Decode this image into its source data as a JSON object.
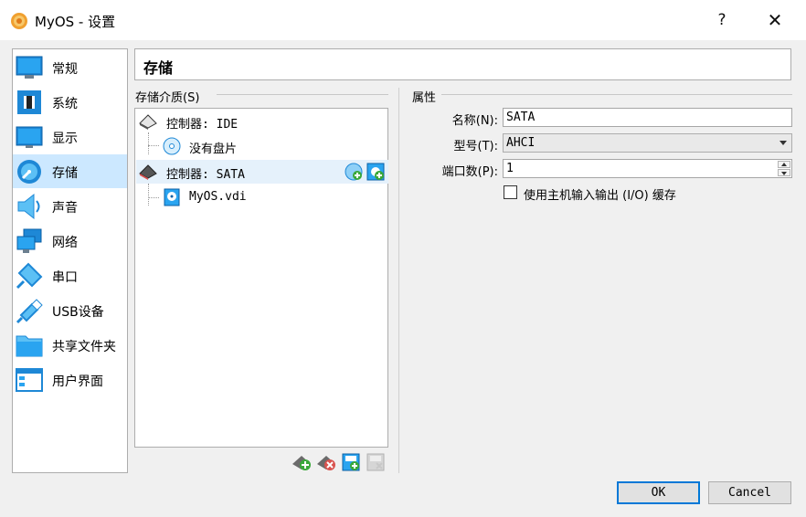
{
  "window": {
    "title": "MyOS - 设置",
    "help_glyph": "?",
    "close_glyph": "✕",
    "icon": "gear-sun-icon"
  },
  "sidebar": {
    "items": [
      {
        "label": "常规",
        "icon": "monitor-icon"
      },
      {
        "label": "系统",
        "icon": "chip-icon"
      },
      {
        "label": "显示",
        "icon": "display-icon"
      },
      {
        "label": "存储",
        "icon": "disk-icon",
        "selected": true
      },
      {
        "label": "声音",
        "icon": "speaker-icon"
      },
      {
        "label": "网络",
        "icon": "network-icon"
      },
      {
        "label": "串口",
        "icon": "serial-port-icon"
      },
      {
        "label": "USB设备",
        "icon": "usb-icon"
      },
      {
        "label": "共享文件夹",
        "icon": "folder-icon"
      },
      {
        "label": "用户界面",
        "icon": "window-ui-icon"
      }
    ]
  },
  "page": {
    "title": "存储"
  },
  "storage": {
    "section_label": "存储介质(S)",
    "tree": [
      {
        "label": "控制器: IDE",
        "icon": "controller-ide-icon"
      },
      {
        "label": "没有盘片",
        "icon": "optical-disc-icon"
      },
      {
        "label": "控制器: SATA",
        "icon": "controller-sata-icon",
        "selected": true
      },
      {
        "label": "MyOS.vdi",
        "icon": "hard-disk-icon"
      }
    ],
    "tools": [
      "add-controller-icon",
      "remove-controller-icon",
      "add-attachment-icon",
      "remove-attachment-icon"
    ]
  },
  "attributes": {
    "section_label": "属性",
    "name_label": "名称(N):",
    "name_value": "SATA",
    "type_label": "型号(T):",
    "type_value": "AHCI",
    "port_label": "端口数(P):",
    "port_value": "1",
    "cache_label": "使用主机输入输出 (I/O) 缓存",
    "cache_checked": false
  },
  "buttons": {
    "ok": "OK",
    "cancel": "Cancel"
  },
  "colors": {
    "selection": "#cce8ff",
    "accent": "#0078d7",
    "icon_blue": "#1e88d6"
  }
}
